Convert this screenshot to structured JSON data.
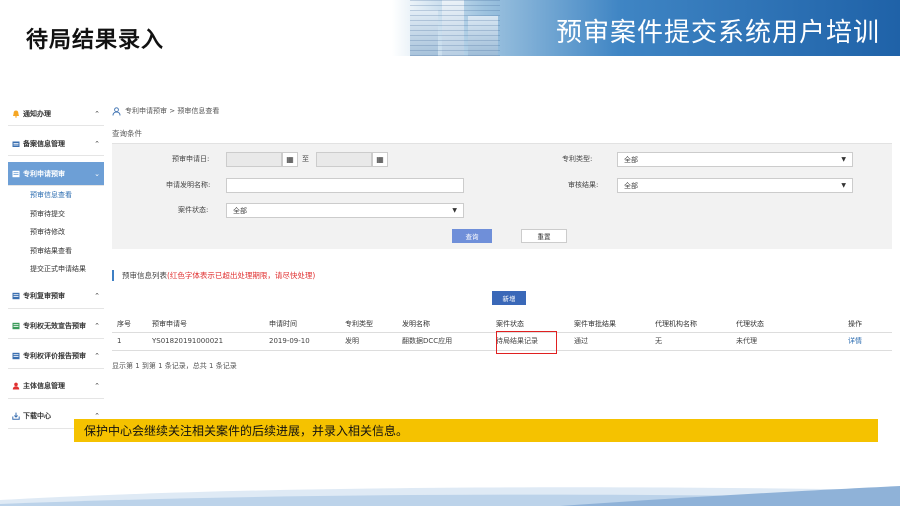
{
  "slide": {
    "title": "待局结果录入",
    "banner_title": "预审案件提交系统用户培训"
  },
  "sidebar": {
    "groups": [
      {
        "label": "通知办理",
        "icon": "bell-icon",
        "color": "#f5a623"
      },
      {
        "label": "备案信息管理",
        "icon": "folder-icon",
        "color": "#3a6fb0"
      },
      {
        "label": "专利申请预审",
        "icon": "document-icon",
        "color": "#ffffff",
        "active": true,
        "items": [
          "预审信息查看",
          "预审待提交",
          "预审待修改",
          "预审结果查看",
          "提交正式申请结果"
        ]
      },
      {
        "label": "专利复审预审",
        "icon": "document-icon",
        "color": "#3a6fb0"
      },
      {
        "label": "专利权无效宣告预审",
        "icon": "document-icon",
        "color": "#3a9b5a"
      },
      {
        "label": "专利权评价报告预审",
        "icon": "document-icon",
        "color": "#3a6fb0"
      },
      {
        "label": "主体信息管理",
        "icon": "user-icon",
        "color": "#e03131"
      },
      {
        "label": "下载中心",
        "icon": "download-icon",
        "color": "#3a6fb0"
      }
    ],
    "chevron_up": "⌃",
    "chevron_down": "⌄"
  },
  "breadcrumb": {
    "text": "专利申请预审  >  预审信息查看"
  },
  "query": {
    "section_title": "查询条件",
    "apply_date_label": "预审申请日:",
    "to_label": "至",
    "patent_type_label": "专利类型:",
    "patent_type_value": "全部",
    "invention_name_label": "申请发明名称:",
    "review_result_label": "审核结果:",
    "review_result_value": "全部",
    "case_status_label": "案件状态:",
    "case_status_value": "全部",
    "search_button": "查询",
    "reset_button": "重置",
    "calendar_glyph": "▦",
    "dropdown_glyph": "▼"
  },
  "list": {
    "title": "预审信息列表",
    "warning": "(红色字体表示已超出处理期限，请尽快处理)",
    "add_button": "新增",
    "columns": [
      "序号",
      "预审申请号",
      "申请时间",
      "专利类型",
      "发明名称",
      "案件状态",
      "案件审批结果",
      "代理机构名称",
      "代理状态",
      "操作"
    ],
    "rows": [
      [
        "1",
        "YS01820191000021",
        "2019-09-10",
        "发明",
        "翻数据DCC应用",
        "待局结果记录",
        "通过",
        "无",
        "未代理",
        "详情"
      ]
    ],
    "paging": "显示第 1 到第 1 条记录，总共 1 条记录"
  },
  "note": {
    "text": "保护中心会继续关注相关案件的后续进展，并录入相关信息。"
  },
  "colors": {
    "banner": "#1f62a8",
    "sidebar_active": "#6d9fd6",
    "primary_button": "#6f8fd9",
    "add_button": "#3a68b8",
    "warning_text": "#e03131",
    "highlight": "#e02020",
    "note_bg": "#f5c200"
  }
}
